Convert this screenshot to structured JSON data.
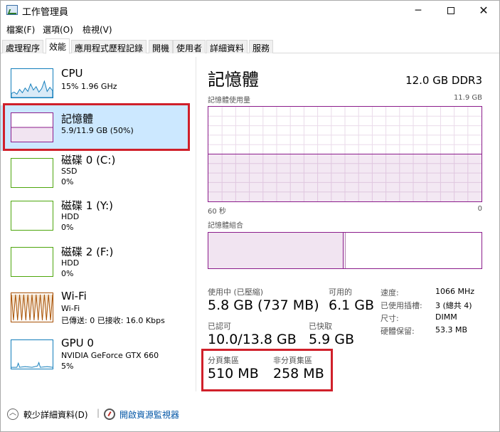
{
  "window": {
    "title": "工作管理員",
    "min_glyph": "─",
    "close_glyph": "✕"
  },
  "menu": [
    "檔案(F)",
    "選項(O)",
    "檢視(V)"
  ],
  "tabs": [
    "處理程序",
    "效能",
    "應用程式歷程記錄",
    "開機",
    "使用者",
    "詳細資料",
    "服務"
  ],
  "active_tab": "效能",
  "left_items": [
    {
      "title": "CPU",
      "line1": "15%  1.96 GHz",
      "line2": "",
      "color": "#117dbb"
    },
    {
      "title": "記憶體",
      "line1": "5.9/11.9 GB (50%)",
      "line2": "",
      "color": "#8b1c8b"
    },
    {
      "title": "磁碟 0 (C:)",
      "line1": "SSD",
      "line2": "0%",
      "color": "#4da60c"
    },
    {
      "title": "磁碟 1 (Y:)",
      "line1": "HDD",
      "line2": "0%",
      "color": "#4da60c"
    },
    {
      "title": "磁碟 2 (F:)",
      "line1": "HDD",
      "line2": "0%",
      "color": "#4da60c"
    },
    {
      "title": "Wi-Fi",
      "line1": "Wi-Fi",
      "line2": "已傳送: 0 已接收: 16.0 Kbps",
      "color": "#a74f01"
    },
    {
      "title": "GPU 0",
      "line1": "NVIDIA GeForce GTX 660",
      "line2": "5%",
      "color": "#117dbb"
    }
  ],
  "memory": {
    "title": "記憶體",
    "spec": "12.0 GB DDR3",
    "usage_label": "記憶體使用量",
    "usage_max": "11.9 GB",
    "time_left": "60 秒",
    "time_right": "0",
    "usage_fraction": 0.5,
    "composition_label": "記憶體組合",
    "in_use_label": "使用中 (已壓縮)",
    "in_use_value": "5.8 GB (737 MB)",
    "available_label": "可用的",
    "available_value": "6.1 GB",
    "committed_label": "已認可",
    "committed_value": "10.0/13.8 GB",
    "cached_label": "已快取",
    "cached_value": "5.9 GB",
    "paged_label": "分頁集區",
    "paged_value": "510 MB",
    "nonpaged_label": "非分頁集區",
    "nonpaged_value": "258 MB",
    "details": [
      {
        "label": "速度:",
        "value": "1066 MHz"
      },
      {
        "label": "已使用插槽:",
        "value": "3 (總共 4)"
      },
      {
        "label": "尺寸:",
        "value": "DIMM"
      },
      {
        "label": "硬體保留:",
        "value": "53.3 MB"
      }
    ]
  },
  "footer": {
    "fewer_details": "較少詳細資料(D)",
    "resource_monitor": "開啟資源監視器",
    "separator": "|"
  },
  "highlight_color": "#d0202a"
}
